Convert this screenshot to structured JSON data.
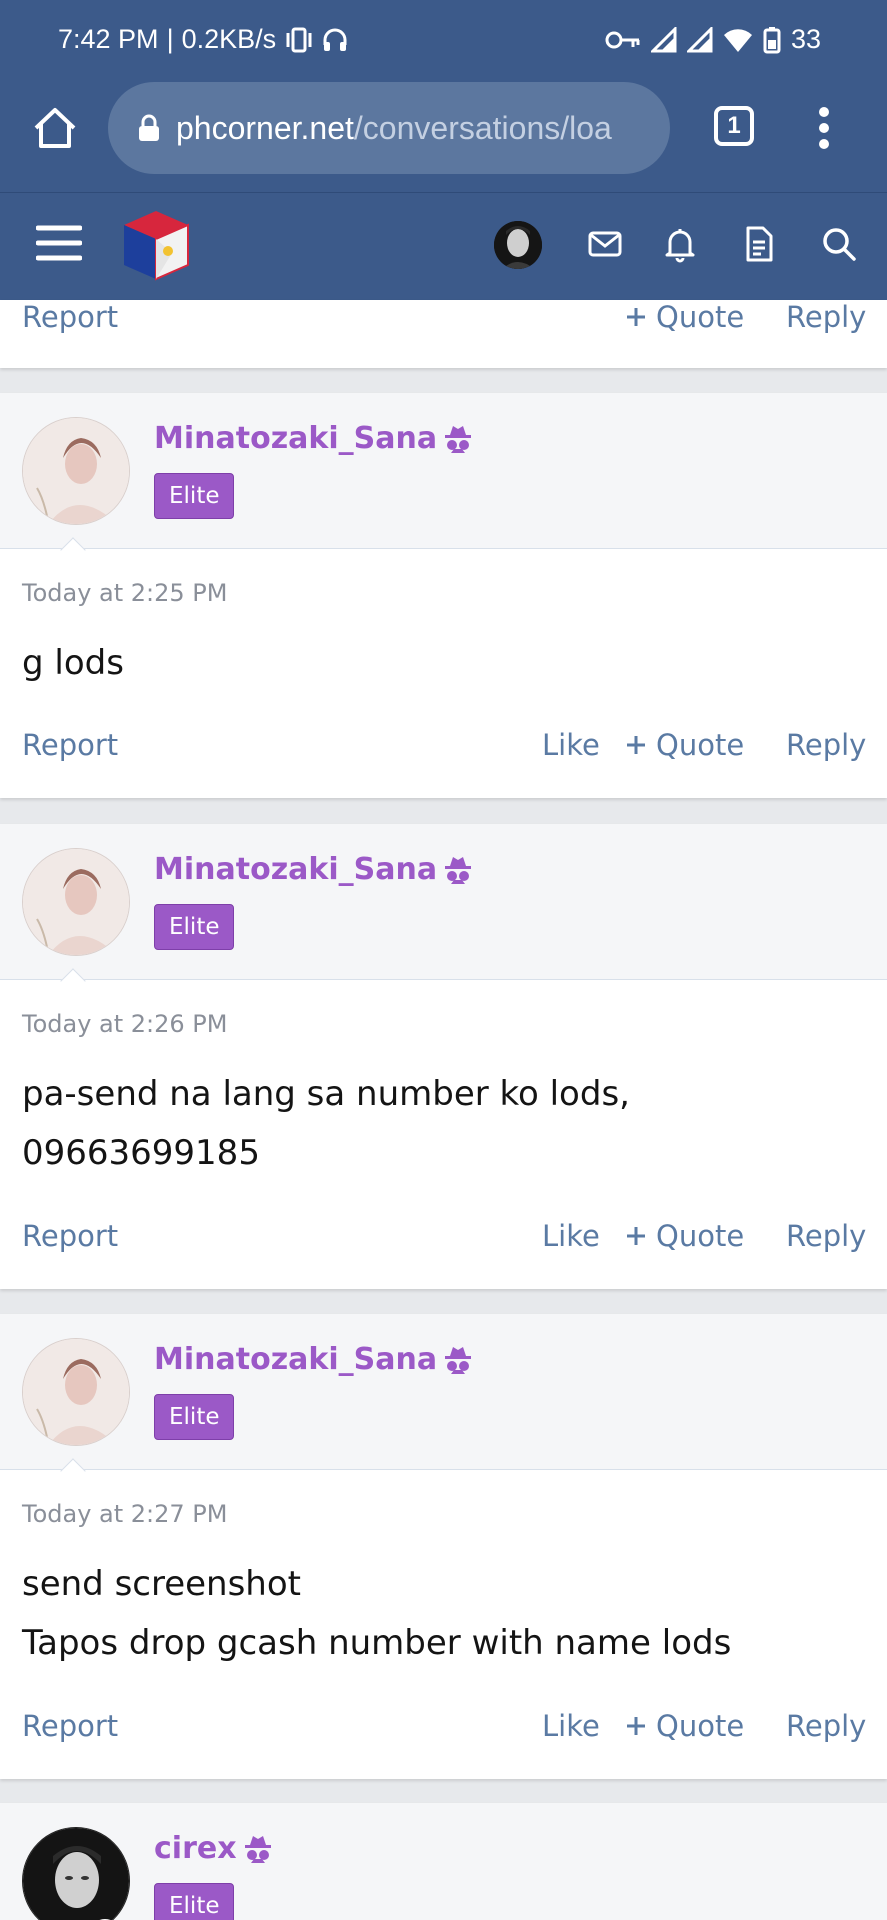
{
  "status_bar": {
    "time": "7:42 PM",
    "net_speed": "0.2KB/s",
    "battery": "33"
  },
  "browser": {
    "url_domain": "phcorner.net",
    "url_path": "/conversations/loa",
    "tab_count": "1"
  },
  "actions": {
    "report": "Report",
    "like": "Like",
    "quote": "Quote",
    "reply": "Reply"
  },
  "messages": [
    {
      "user": "Minatozaki_Sana",
      "role": "Elite",
      "time": "Today at 2:25 PM",
      "lines": [
        "g lods"
      ]
    },
    {
      "user": "Minatozaki_Sana",
      "role": "Elite",
      "time": "Today at 2:26 PM",
      "lines": [
        "pa-send na lang sa number ko lods,",
        "09663699185"
      ]
    },
    {
      "user": "Minatozaki_Sana",
      "role": "Elite",
      "time": "Today at 2:27 PM",
      "lines": [
        "send screenshot",
        "Tapos drop gcash number with name lods"
      ]
    },
    {
      "user": "cirex",
      "role": "Elite"
    }
  ],
  "colors": {
    "header_bg": "#3c5a8a",
    "username": "#9b59c7",
    "action_link": "#5a7aa3"
  }
}
